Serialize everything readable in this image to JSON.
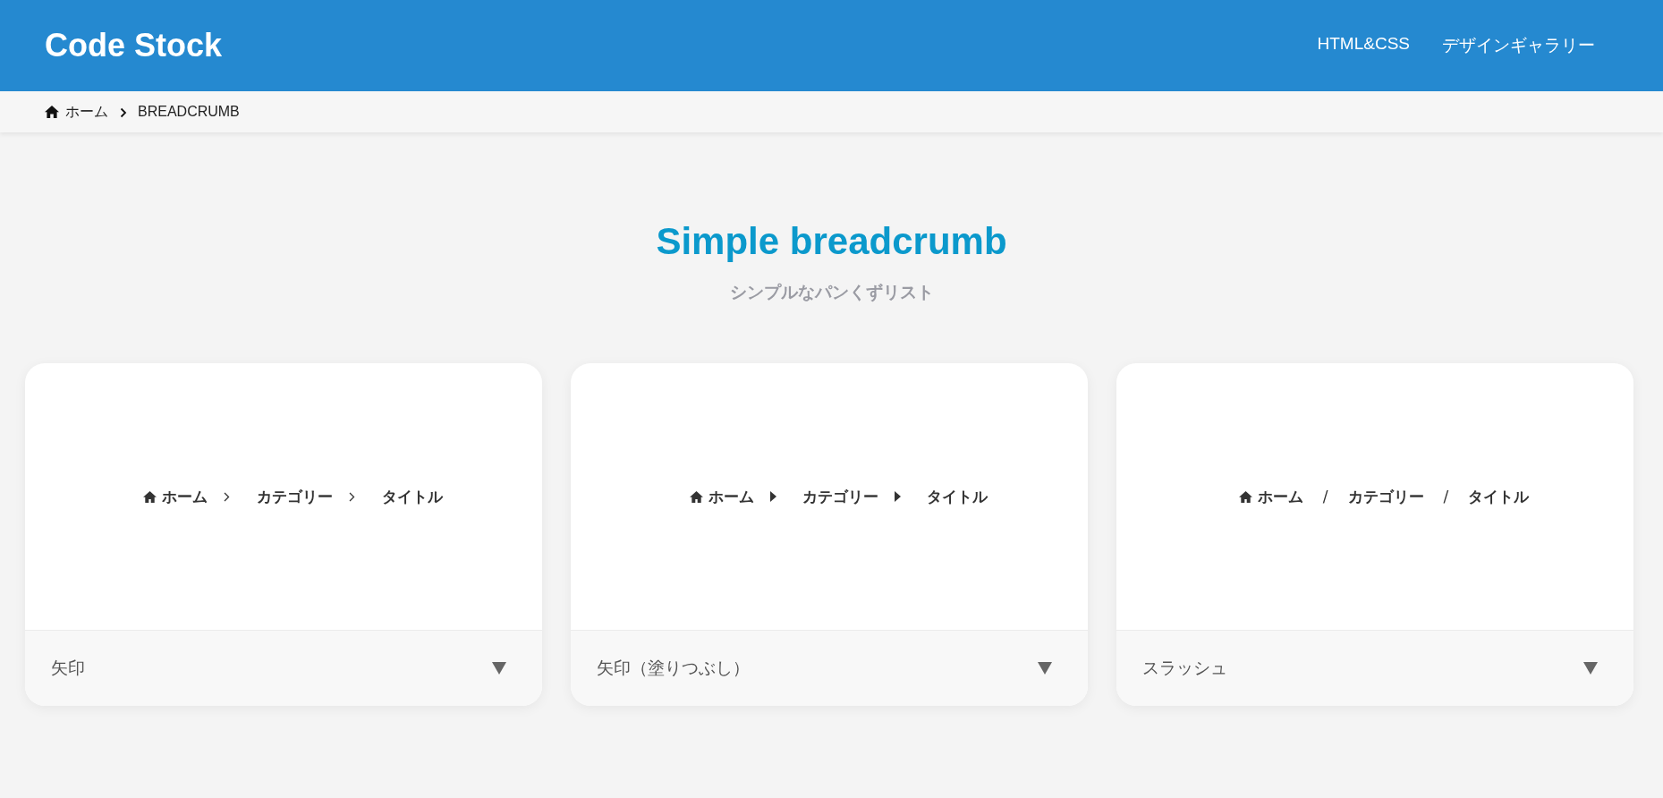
{
  "header": {
    "logo": "Code Stock",
    "nav": [
      {
        "label": "HTML&CSS"
      },
      {
        "label": "デザインギャラリー"
      }
    ]
  },
  "breadcrumb": {
    "items": [
      "ホーム",
      "BREADCRUMB"
    ]
  },
  "section": {
    "title": "Simple breadcrumb",
    "subtitle": "シンプルなパンくずリスト"
  },
  "cards": [
    {
      "kind": "chevron",
      "crumbs": [
        "ホーム",
        "カテゴリー",
        "タイトル"
      ],
      "label": "矢印",
      "expanded": false
    },
    {
      "kind": "triangle",
      "crumbs": [
        "ホーム",
        "カテゴリー",
        "タイトル"
      ],
      "label": "矢印（塗りつぶし）",
      "expanded": false
    },
    {
      "kind": "slash",
      "crumbs": [
        "ホーム",
        "カテゴリー",
        "タイトル"
      ],
      "separators": [
        "/",
        "/"
      ],
      "label": "スラッシュ",
      "expanded": false
    }
  ]
}
